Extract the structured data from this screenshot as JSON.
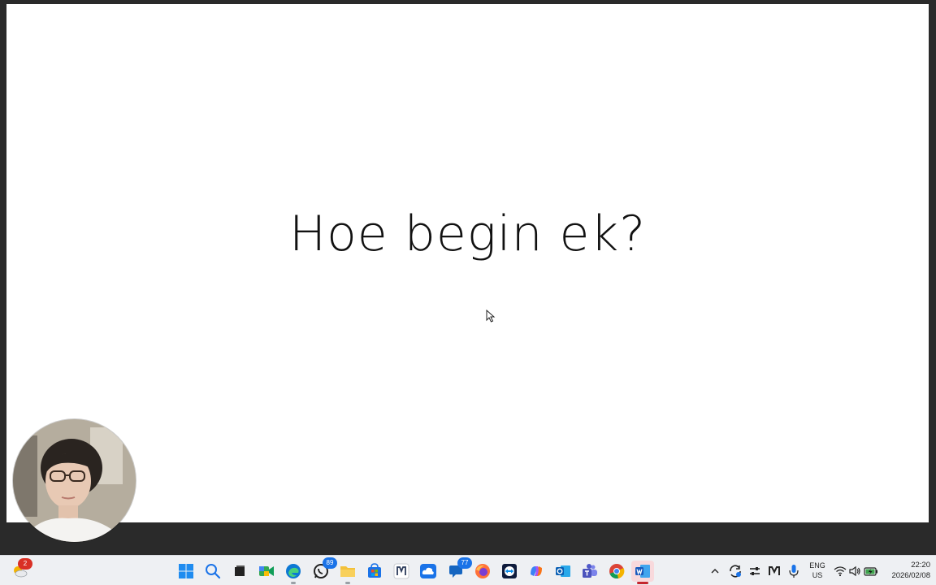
{
  "slide": {
    "title": "Hoe begin ek?"
  },
  "taskbar": {
    "widgets_badge": "2",
    "apps": [
      {
        "name": "start",
        "icon": "windows-logo-icon"
      },
      {
        "name": "search",
        "icon": "search-icon"
      },
      {
        "name": "task-view",
        "icon": "task-view-icon"
      },
      {
        "name": "meet",
        "icon": "video-call-icon"
      },
      {
        "name": "edge",
        "icon": "edge-icon"
      },
      {
        "name": "whatsapp",
        "icon": "whatsapp-icon",
        "badge": "89"
      },
      {
        "name": "file-explorer",
        "icon": "folder-icon"
      },
      {
        "name": "store",
        "icon": "store-icon"
      },
      {
        "name": "app-m",
        "icon": "m-logo-icon"
      },
      {
        "name": "cloud",
        "icon": "cloud-icon"
      },
      {
        "name": "chat",
        "icon": "chat-icon",
        "badge": "77"
      },
      {
        "name": "firefox",
        "icon": "firefox-icon"
      },
      {
        "name": "teamviewer",
        "icon": "teamviewer-icon"
      },
      {
        "name": "copilot",
        "icon": "copilot-icon"
      },
      {
        "name": "outlook",
        "icon": "outlook-icon"
      },
      {
        "name": "teams",
        "icon": "teams-icon"
      },
      {
        "name": "chrome",
        "icon": "chrome-icon"
      },
      {
        "name": "word",
        "icon": "word-icon"
      }
    ],
    "language": {
      "line1": "ENG",
      "line2": "US"
    },
    "clock": {
      "time": "22:20",
      "date": "2026/02/08"
    }
  },
  "colors": {
    "background": "#2a2a2a",
    "slide": "#ffffff",
    "taskbar": "#eef0f3",
    "accent_blue": "#1a73e8",
    "active_red": "#c4262e"
  }
}
